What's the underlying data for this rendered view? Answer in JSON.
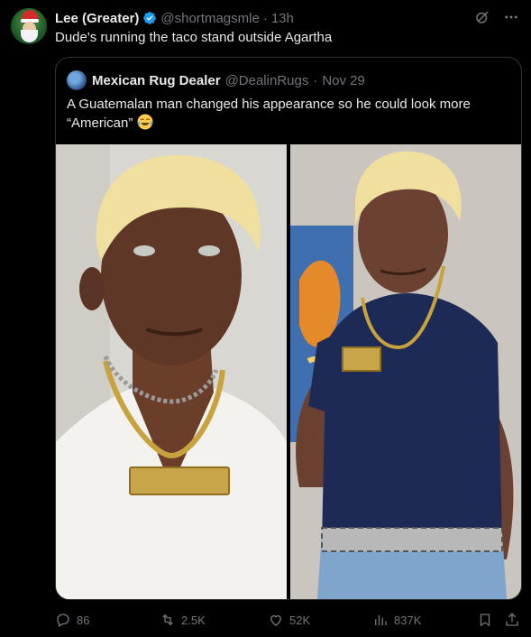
{
  "tweet": {
    "author_name": "Lee (Greater)",
    "handle": "@shortmagsmle",
    "time": "13h",
    "text": "Dude's running the taco stand outside Agartha"
  },
  "quoted": {
    "author_name": "Mexican Rug Dealer",
    "handle": "@DealinRugs",
    "date": "Nov 29",
    "text": "A Guatemalan man changed his appearance so he could look more “American”"
  },
  "actions": {
    "replies": "86",
    "reposts": "2.5K",
    "likes": "52K",
    "views": "837K"
  },
  "icons": {
    "verified": "verified-badge-icon",
    "grok": "grok-icon",
    "more": "more-icon",
    "emoji": "laughing-tears-emoji",
    "reply": "reply-icon",
    "repost": "repost-icon",
    "like": "heart-icon",
    "views": "views-icon",
    "bookmark": "bookmark-icon",
    "share": "share-icon"
  },
  "colors": {
    "background": "#000000",
    "text": "#e7e9ea",
    "muted": "#71767b",
    "verified": "#1d9bf0",
    "border": "#2f3336"
  }
}
